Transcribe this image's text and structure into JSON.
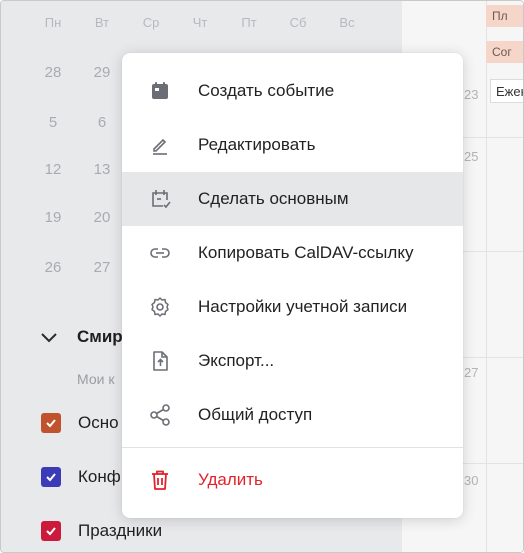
{
  "mini_calendar": {
    "weekdays": [
      "Пн",
      "Вт",
      "Ср",
      "Чт",
      "Пт",
      "Сб",
      "Вс"
    ],
    "dates": [
      [
        "28",
        "29"
      ],
      [
        "5",
        "6"
      ],
      [
        "12",
        "13"
      ],
      [
        "19",
        "20"
      ],
      [
        "26",
        "27"
      ]
    ]
  },
  "accounts": {
    "title": "Смир",
    "subheader": "Мои к",
    "calendars": [
      {
        "label": "Осно",
        "color": "#c0522d"
      },
      {
        "label": "Конф",
        "color": "#3b3bb8"
      },
      {
        "label": "Праздники",
        "color": "#cc1a3d"
      }
    ]
  },
  "grid": {
    "events": [
      "Пл",
      "Сог"
    ],
    "tab": "Ежен",
    "numbers": [
      "23",
      "25",
      "27",
      "30"
    ]
  },
  "context_menu": {
    "items": [
      {
        "label": "Создать событие",
        "icon": "calendar-filled-icon"
      },
      {
        "label": "Редактировать",
        "icon": "pencil-icon"
      },
      {
        "label": "Сделать основным",
        "icon": "calendar-check-icon"
      },
      {
        "label": "Копировать CalDAV-ссылку",
        "icon": "link-icon"
      },
      {
        "label": "Настройки учетной записи",
        "icon": "gear-icon"
      },
      {
        "label": "Экспорт...",
        "icon": "file-export-icon"
      },
      {
        "label": "Общий доступ",
        "icon": "share-icon"
      },
      {
        "label": "Удалить",
        "icon": "trash-icon"
      }
    ]
  },
  "colors": {
    "danger": "#e2232b",
    "hover": "#e6e7e9",
    "icon": "#6b6e75"
  }
}
